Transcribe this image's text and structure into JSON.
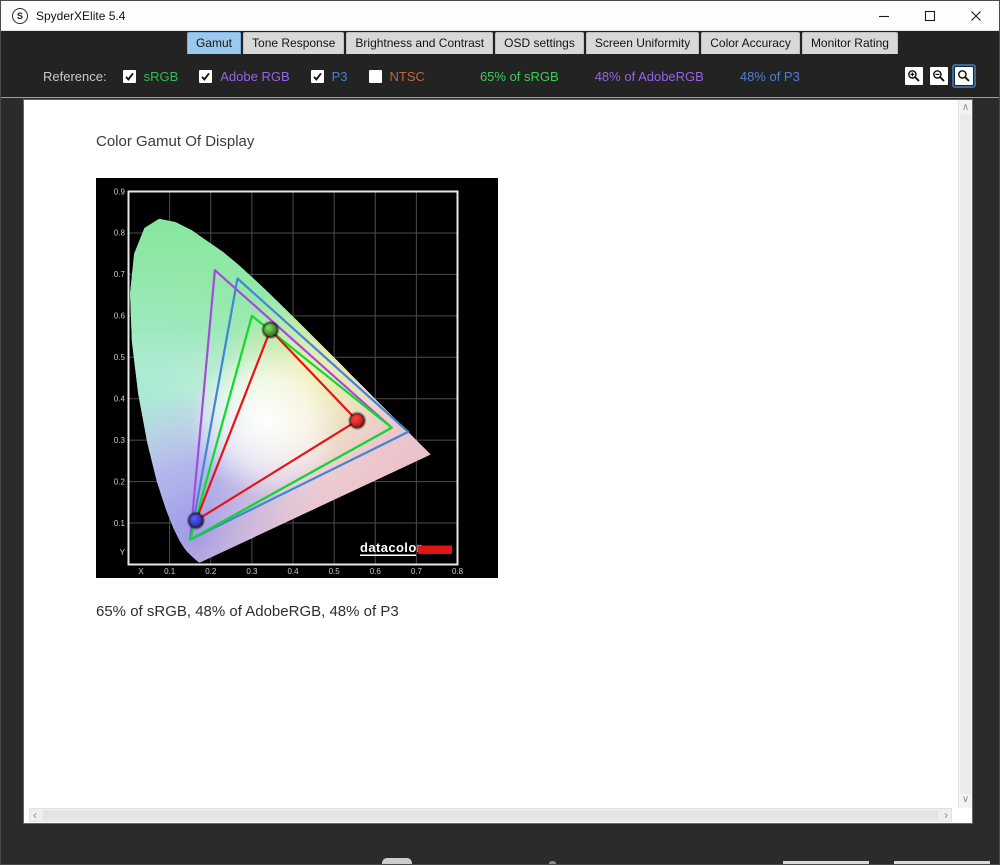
{
  "window": {
    "title": "SpyderXElite 5.4",
    "logo_letter": "S",
    "controls": [
      {
        "name": "minimize"
      },
      {
        "name": "maximize"
      },
      {
        "name": "close"
      }
    ]
  },
  "tabs": [
    {
      "label": "Gamut",
      "selected": true
    },
    {
      "label": "Tone Response",
      "selected": false
    },
    {
      "label": "Brightness and Contrast",
      "selected": false
    },
    {
      "label": "OSD settings",
      "selected": false
    },
    {
      "label": "Screen Uniformity",
      "selected": false
    },
    {
      "label": "Color Accuracy",
      "selected": false
    },
    {
      "label": "Monitor Rating",
      "selected": false
    }
  ],
  "reference_bar": {
    "label": "Reference:",
    "options": [
      {
        "label": "sRGB",
        "checked": true,
        "color": "#2fbf52"
      },
      {
        "label": "Adobe RGB",
        "checked": true,
        "color": "#9663e2"
      },
      {
        "label": "P3",
        "checked": true,
        "color": "#4a80d0"
      },
      {
        "label": "NTSC",
        "checked": false,
        "color": "#b9693f"
      }
    ],
    "stats": [
      {
        "text": "65% of sRGB",
        "color": "#38cf55"
      },
      {
        "text": "48% of AdobeRGB",
        "color": "#9663e2"
      },
      {
        "text": "48% of P3",
        "color": "#4a80d0"
      }
    ],
    "zoom_buttons": [
      {
        "name": "zoom-in",
        "selected": false
      },
      {
        "name": "zoom-out",
        "selected": false
      },
      {
        "name": "zoom-reset",
        "selected": true
      }
    ]
  },
  "content": {
    "title": "Color Gamut Of Display",
    "caption": "65% of sRGB, 48% of AdobeRGB, 48% of P3"
  },
  "chart_data": {
    "type": "line",
    "subtype": "cie-1931-chromaticity-diagram",
    "title": "Color Gamut Of Display",
    "xlabel": "X",
    "ylabel": "Y",
    "xlim": [
      0,
      0.8
    ],
    "ylim": [
      0,
      0.9
    ],
    "x_ticks": [
      0.1,
      0.2,
      0.3,
      0.4,
      0.5,
      0.6,
      0.7,
      0.8
    ],
    "y_ticks": [
      0.1,
      0.2,
      0.3,
      0.4,
      0.5,
      0.6,
      0.7,
      0.8,
      0.9
    ],
    "grid": true,
    "background": "#000000",
    "plot_border_color": "#e8e8e8",
    "watermark": "datacolor",
    "series": [
      {
        "name": "Adobe RGB",
        "color": "#a649dd",
        "closed": true,
        "points": [
          [
            0.64,
            0.33
          ],
          [
            0.21,
            0.71
          ],
          [
            0.15,
            0.06
          ]
        ]
      },
      {
        "name": "P3",
        "color": "#4285d4",
        "closed": true,
        "points": [
          [
            0.68,
            0.32
          ],
          [
            0.265,
            0.69
          ],
          [
            0.15,
            0.06
          ]
        ]
      },
      {
        "name": "sRGB",
        "color": "#0ddc2a",
        "closed": true,
        "points": [
          [
            0.64,
            0.33
          ],
          [
            0.3,
            0.6
          ],
          [
            0.15,
            0.06
          ]
        ]
      },
      {
        "name": "Display",
        "color": "#e41414",
        "closed": true,
        "points": [
          [
            0.556,
            0.347
          ],
          [
            0.345,
            0.566
          ],
          [
            0.164,
            0.106
          ]
        ]
      }
    ],
    "markers": [
      {
        "x": 0.345,
        "y": 0.566,
        "color": "#55a039"
      },
      {
        "x": 0.556,
        "y": 0.347,
        "color": "#df2b2b"
      },
      {
        "x": 0.164,
        "y": 0.106,
        "color": "#3a42c4"
      }
    ]
  }
}
